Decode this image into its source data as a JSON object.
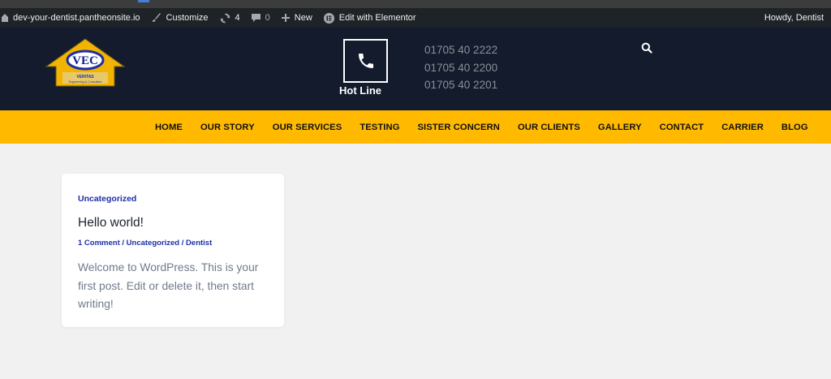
{
  "admin_bar": {
    "site": "dev-your-dentist.pantheonsite.io",
    "customize": "Customize",
    "updates_count": "4",
    "comments_count": "0",
    "new": "New",
    "edit_elementor": "Edit with Elementor",
    "howdy": "Howdy, Dentist"
  },
  "header": {
    "logo_text": "VEC",
    "logo_subtitle": "VERITAS",
    "logo_tagline": "Engineering & Consultant",
    "hotline_label": "Hot Line",
    "phones": [
      "01705 40 2222",
      "01705 40 2200",
      "01705 40 2201"
    ]
  },
  "nav": {
    "items": [
      "HOME",
      "OUR STORY",
      "OUR SERVICES",
      "TESTING",
      "SISTER CONCERN",
      "OUR CLIENTS",
      "GALLERY",
      "CONTACT",
      "CARRIER",
      "BLOG"
    ]
  },
  "post": {
    "category": "Uncategorized",
    "title": "Hello world!",
    "meta_comments": "1 Comment",
    "meta_separator": " / ",
    "meta_category": "Uncategorized",
    "meta_author": "Dentist",
    "excerpt": "Welcome to WordPress. This is your first post. Edit or delete it, then start writing!"
  },
  "colors": {
    "admin_bar_bg": "#1d2327",
    "header_bg": "#141b2c",
    "nav_bg": "#ffba00",
    "link_blue": "#1d2fa8",
    "page_bg": "#f1f1f1"
  }
}
